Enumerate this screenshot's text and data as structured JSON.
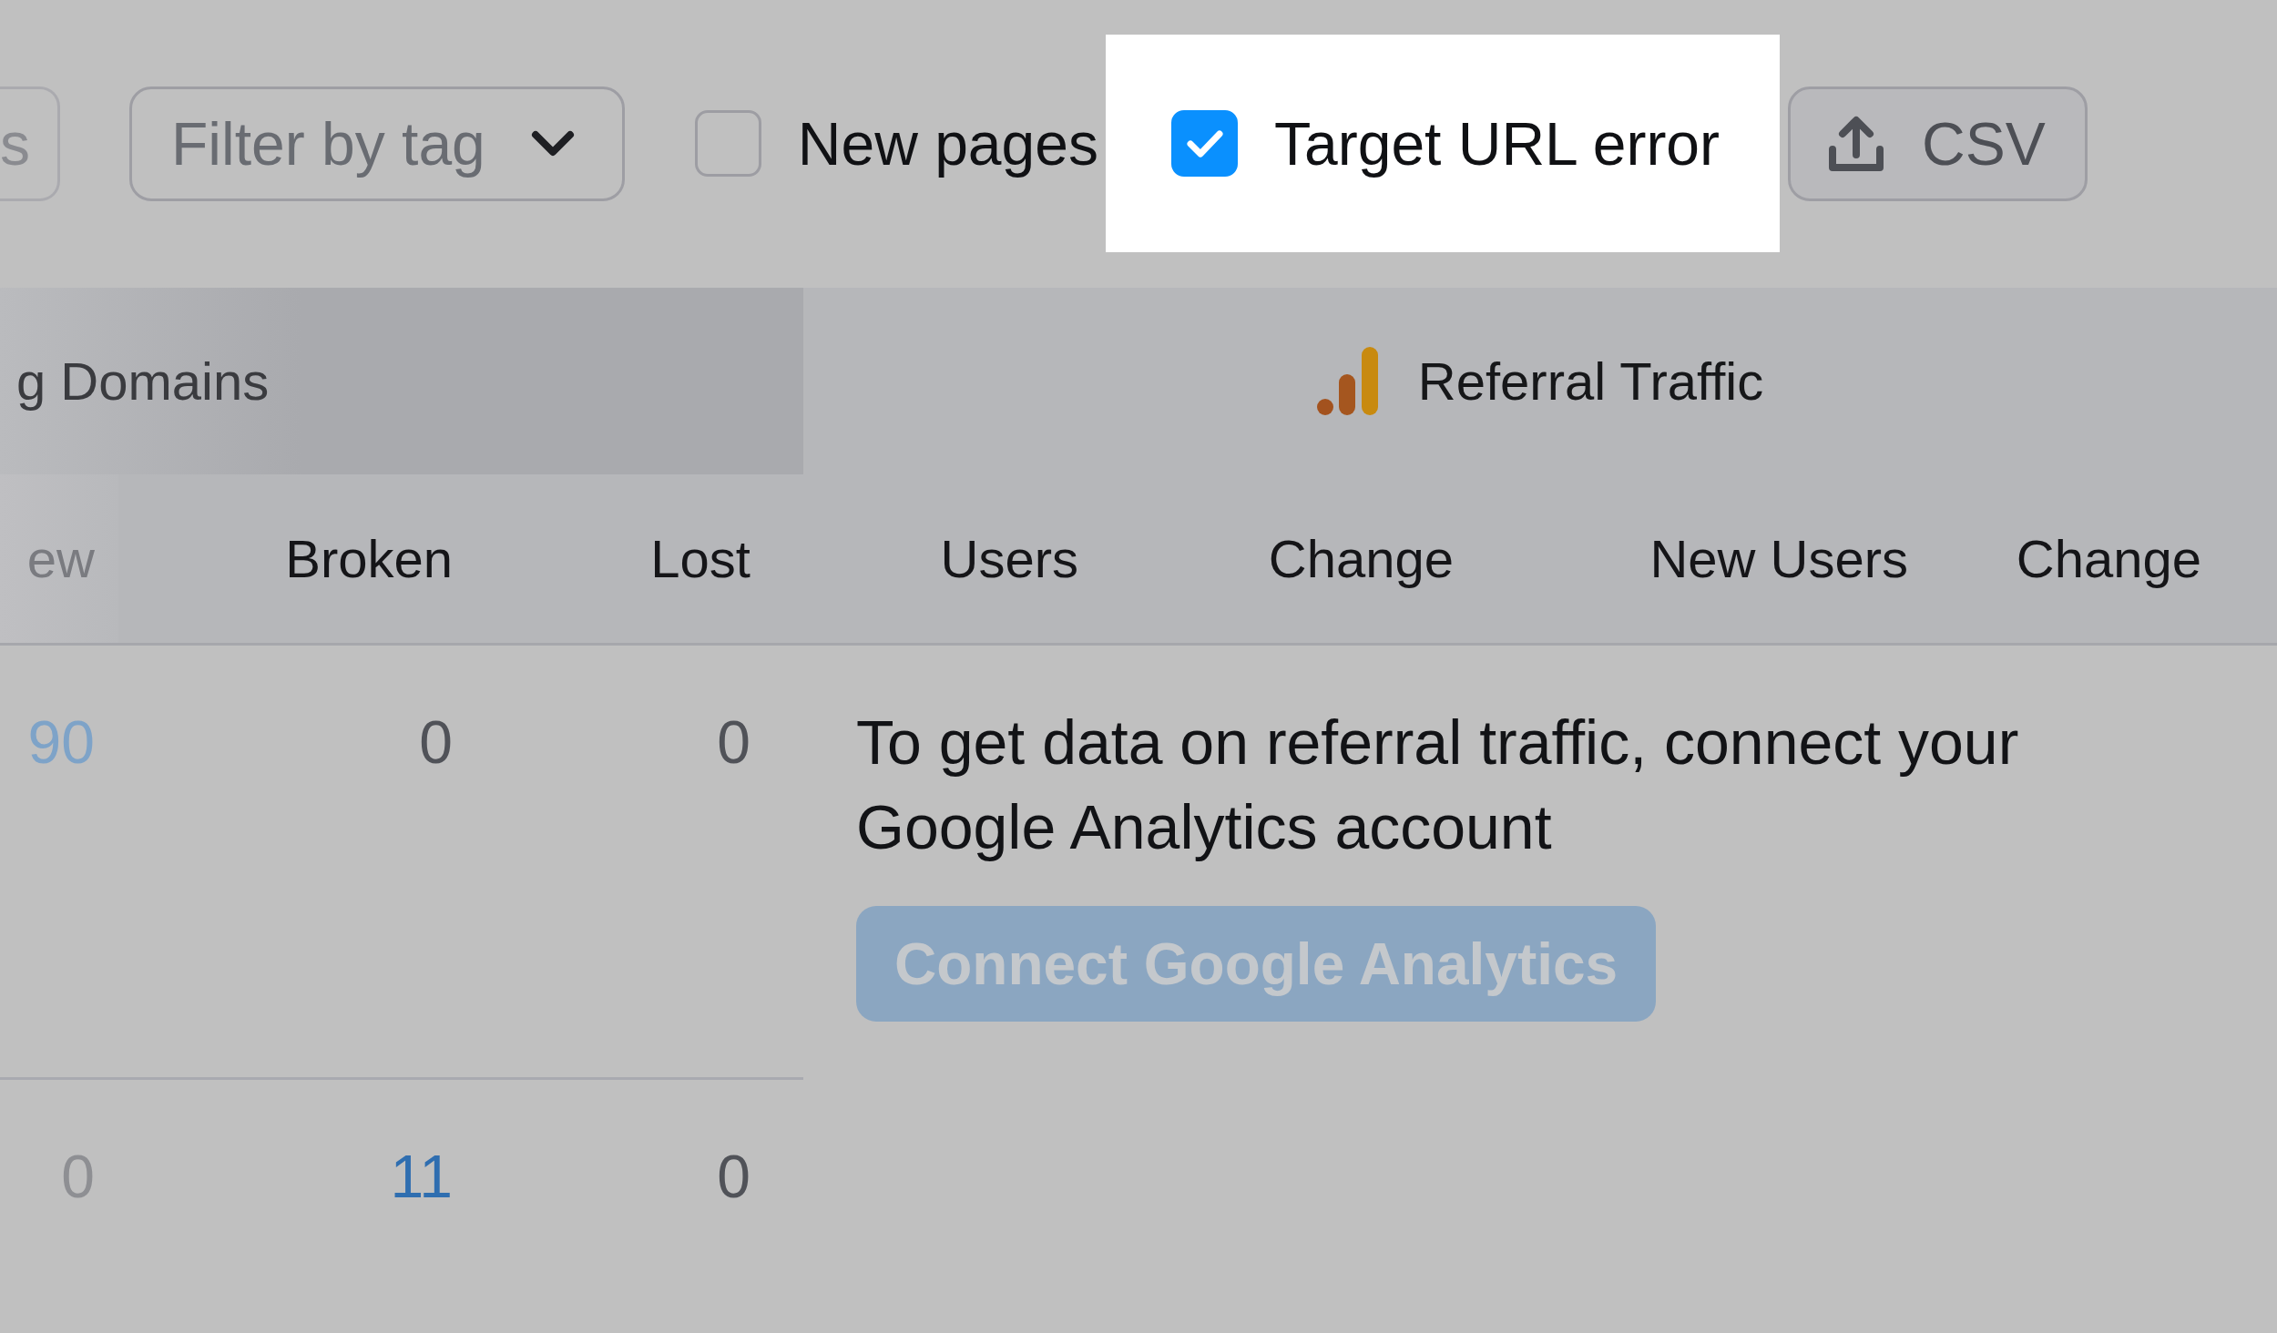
{
  "toolbar": {
    "partial_button": {
      "label": "s"
    },
    "tag_filter": {
      "label": "Filter by tag"
    },
    "checkboxes": [
      {
        "label": "New pages",
        "checked": false,
        "highlighted": false
      },
      {
        "label": "Target URL error",
        "checked": true,
        "highlighted": true
      }
    ],
    "export_button": {
      "label": "CSV"
    }
  },
  "table": {
    "groups": [
      {
        "title": "g Domains",
        "kind": "plain",
        "columns": [
          "ew",
          "Broken",
          "Lost"
        ]
      },
      {
        "title": "Referral Traffic",
        "kind": "analytics",
        "columns": [
          "Users",
          "Change",
          "New Users",
          "Change"
        ]
      }
    ],
    "rows": [
      {
        "cells": [
          {
            "value": "90",
            "link": true
          },
          {
            "value": "0",
            "link": false
          },
          {
            "value": "0",
            "link": false
          }
        ],
        "message": {
          "text": "To get data on referral traffic, connect your Google Analytics account",
          "button": "Connect Google Analytics"
        }
      },
      {
        "cells": [
          {
            "value": "0",
            "link": false
          },
          {
            "value": "11",
            "link": true
          },
          {
            "value": "0",
            "link": false
          }
        ]
      }
    ]
  }
}
